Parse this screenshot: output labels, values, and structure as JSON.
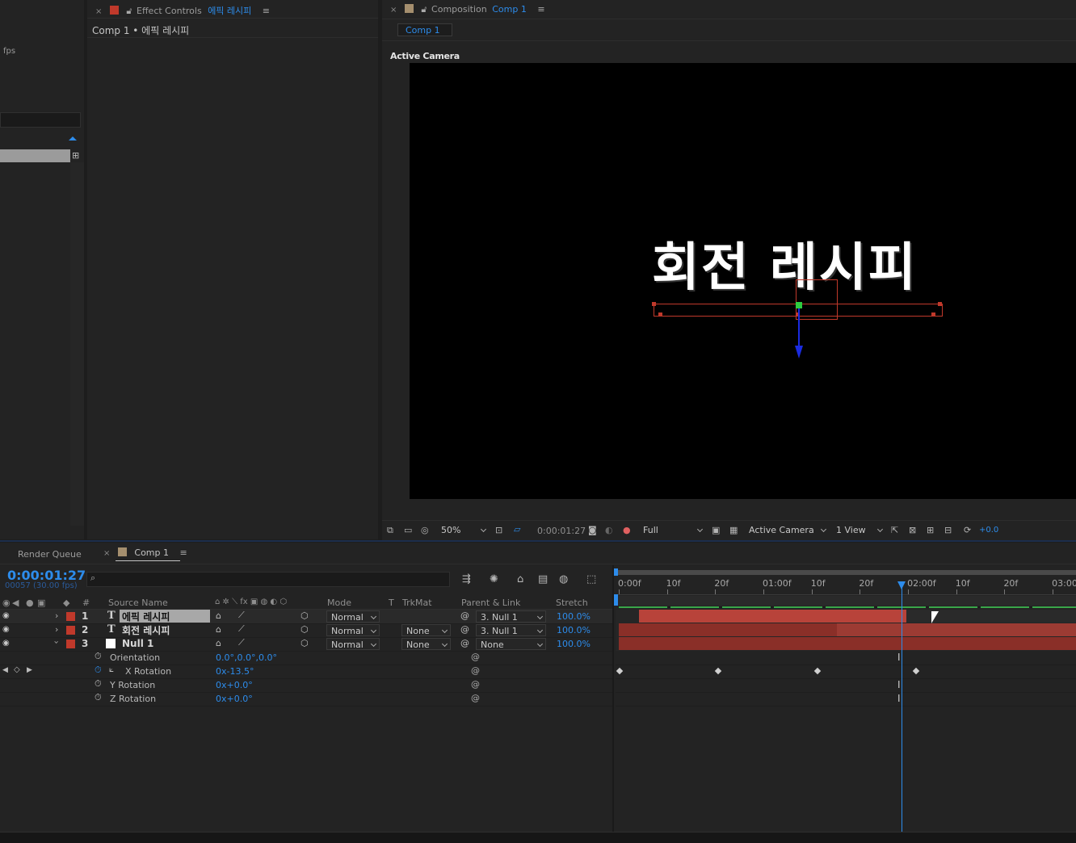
{
  "project_panel": {
    "fps_label": "fps"
  },
  "effect_controls": {
    "tab_prefix": "Effect Controls",
    "tab_layer": "에픽 레시피",
    "subtitle": "Comp 1 • 에픽 레시피"
  },
  "composition": {
    "tab_prefix": "Composition",
    "tab_comp": "Comp 1",
    "subtab": "Comp 1",
    "view_label": "Active Camera",
    "main_text": "회전 레시피",
    "colors": {
      "text": "#ffffff",
      "outline": "#c0392b",
      "y_axis": "#1a2be0",
      "anchor": "#2ecc40"
    }
  },
  "viewer_toolbar": {
    "zoom": "50%",
    "timecode": "0:00:01:27",
    "resolution": "Full",
    "camera": "Active Camera",
    "views": "1 View",
    "exposure": "+0.0"
  },
  "timeline_tabs": {
    "render_queue": "Render Queue",
    "comp": "Comp 1"
  },
  "timeline": {
    "current_time": "0:00:01:27",
    "frame_info": "00057 (30.00 fps)",
    "columns": {
      "number": "#",
      "source_name": "Source Name",
      "mode": "Mode",
      "t": "T",
      "trkmat": "TrkMat",
      "parent": "Parent & Link",
      "stretch": "Stretch"
    },
    "layers": [
      {
        "num": "1",
        "type_icon": "T",
        "name": "에픽 레시피",
        "mode": "Normal",
        "trkmat": "",
        "parent": "3. Null 1",
        "stretch": "100.0%",
        "color": "#c0392b",
        "selected": true
      },
      {
        "num": "2",
        "type_icon": "T",
        "name": "회전 레시피",
        "mode": "Normal",
        "trkmat": "None",
        "parent": "3. Null 1",
        "stretch": "100.0%",
        "color": "#c0392b",
        "selected": false
      },
      {
        "num": "3",
        "type_icon": "",
        "name": "Null 1",
        "mode": "Normal",
        "trkmat": "None",
        "parent": "None",
        "stretch": "100.0%",
        "color": "#c0392b",
        "selected": false
      }
    ],
    "properties": [
      {
        "name": "Orientation",
        "value": "0.0°,0.0°,0.0°"
      },
      {
        "name": "X Rotation",
        "value": "0x-13.5°"
      },
      {
        "name": "Y Rotation",
        "value": "0x+0.0°"
      },
      {
        "name": "Z Rotation",
        "value": "0x+0.0°"
      }
    ],
    "ruler_labels": [
      "0:00f",
      "10f",
      "20f",
      "01:00f",
      "10f",
      "20f",
      "02:00f",
      "10f",
      "20f",
      "03:00f"
    ],
    "playhead_fraction": 0.621
  }
}
